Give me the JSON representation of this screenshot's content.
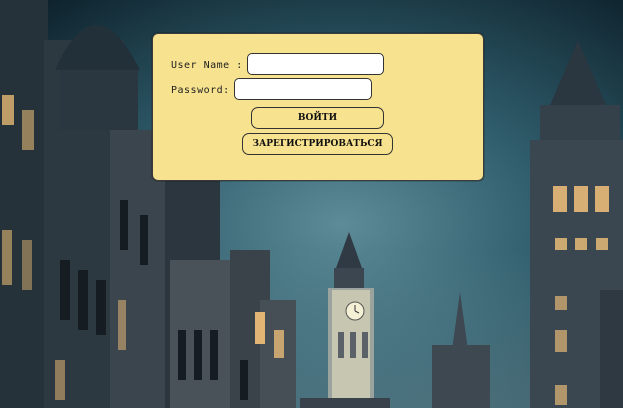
{
  "form": {
    "username_label": "User Name :",
    "username_value": "",
    "password_label": "Password:",
    "password_value": "",
    "login_button": "ВОЙТИ",
    "register_button": "ЗАРЕГИСТРИРОВАТЬСЯ"
  },
  "colors": {
    "panel": "#f7e28f",
    "sky_dark": "#0f2a36",
    "sky_light": "#5b8a96",
    "window_glow": "#f3c27a"
  },
  "background": {
    "scene": "london-night-street-with-clock-tower",
    "icons": [
      "clock-tower-icon",
      "window-light-icon"
    ]
  }
}
